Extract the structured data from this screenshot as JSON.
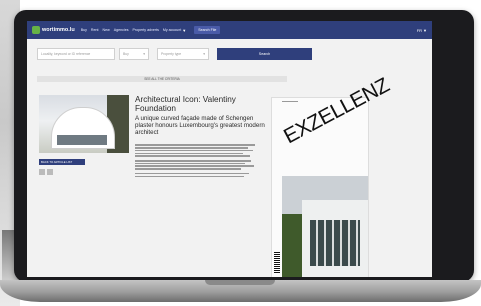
{
  "site": {
    "logo_text": "wortimmo.lu",
    "nav_items": [
      "Buy",
      "Rent",
      "New",
      "Agencies",
      "Property adverts"
    ],
    "my_account": "My account",
    "cta": "Search File",
    "lang": "FR"
  },
  "search": {
    "location_placeholder": "Locality, keyword or ID reference",
    "transaction_value": "Buy",
    "type_value": "Property type",
    "submit_label": "Search",
    "criteria_label": "SEE ALL THE CRITERIA"
  },
  "article": {
    "title": "Architectural Icon: Valentiny Foundation",
    "subtitle": "A unique curved façade made of Schengen plaster honours Luxembourg's greatest modern architect",
    "back_label": "BACK TO ARTICLE LIST"
  },
  "magazine": {
    "title": "EXZELLENZ"
  },
  "colors": {
    "nav_bg": "#2f3f7c",
    "accent": "#66b246"
  }
}
